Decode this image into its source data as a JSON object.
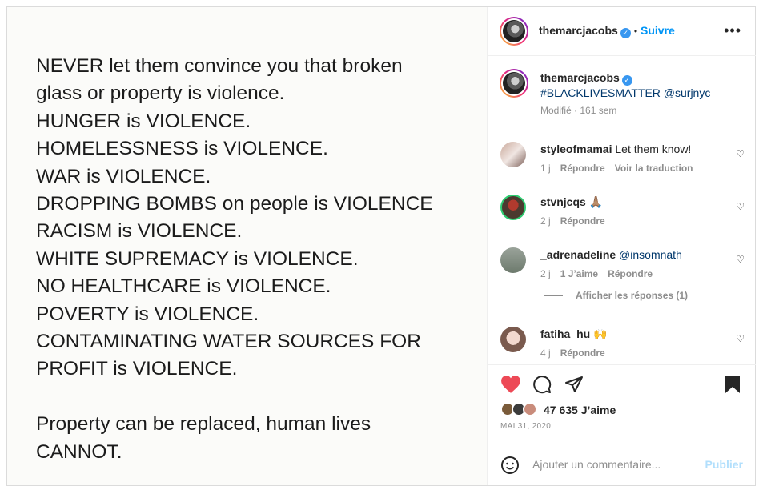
{
  "post_image": {
    "lines": [
      "NEVER let them convince you that broken",
      "glass or property is violence.",
      "HUNGER is VIOLENCE.",
      "HOMELESSNESS is VIOLENCE.",
      "WAR is VIOLENCE.",
      "DROPPING BOMBS on people is VIOLENCE",
      "RACISM is VIOLENCE.",
      "WHITE SUPREMACY is VIOLENCE.",
      "NO HEALTHCARE is VIOLENCE.",
      "POVERTY is VIOLENCE.",
      "CONTAMINATING WATER SOURCES FOR",
      "PROFIT is VIOLENCE."
    ],
    "closing": [
      "Property can be replaced, human lives",
      "CANNOT."
    ]
  },
  "header": {
    "username": "themarcjacobs",
    "separator": "•",
    "follow_label": "Suivre",
    "more": "•••"
  },
  "caption": {
    "username": "themarcjacobs",
    "text": "#BLACKLIVESMATTER @surjnyc",
    "meta": "Modifié · 161 sem"
  },
  "comments": [
    {
      "user": "styleofmamai",
      "text": "Let them know!",
      "time": "1 j",
      "likes": "",
      "reply": "Répondre",
      "translate": "Voir la traduction"
    },
    {
      "user": "stvnjcqs",
      "text": "🙏🏽",
      "time": "2 j",
      "likes": "",
      "reply": "Répondre",
      "translate": ""
    },
    {
      "user": "_adrenadeline",
      "text": "@insomnath",
      "time": "2 j",
      "likes": "1 J’aime",
      "reply": "Répondre",
      "translate": ""
    },
    {
      "user": "fatiha_hu",
      "text": "🙌",
      "time": "4 j",
      "likes": "",
      "reply": "Répondre",
      "translate": ""
    }
  ],
  "view_replies": "Afficher les réponses (1)",
  "actions": {
    "likes": "47 635 J’aime",
    "date": "MAI 31, 2020"
  },
  "add_comment": {
    "placeholder": "Ajouter un commentaire...",
    "post_label": "Publier"
  },
  "colors": {
    "accent": "#0095f6",
    "like": "#ed4956",
    "text": "#262626",
    "muted": "#8e8e8e"
  },
  "icons": [
    "verified-icon",
    "more-icon",
    "heart-icon",
    "comment-icon",
    "share-icon",
    "bookmark-icon",
    "emoji-icon"
  ]
}
